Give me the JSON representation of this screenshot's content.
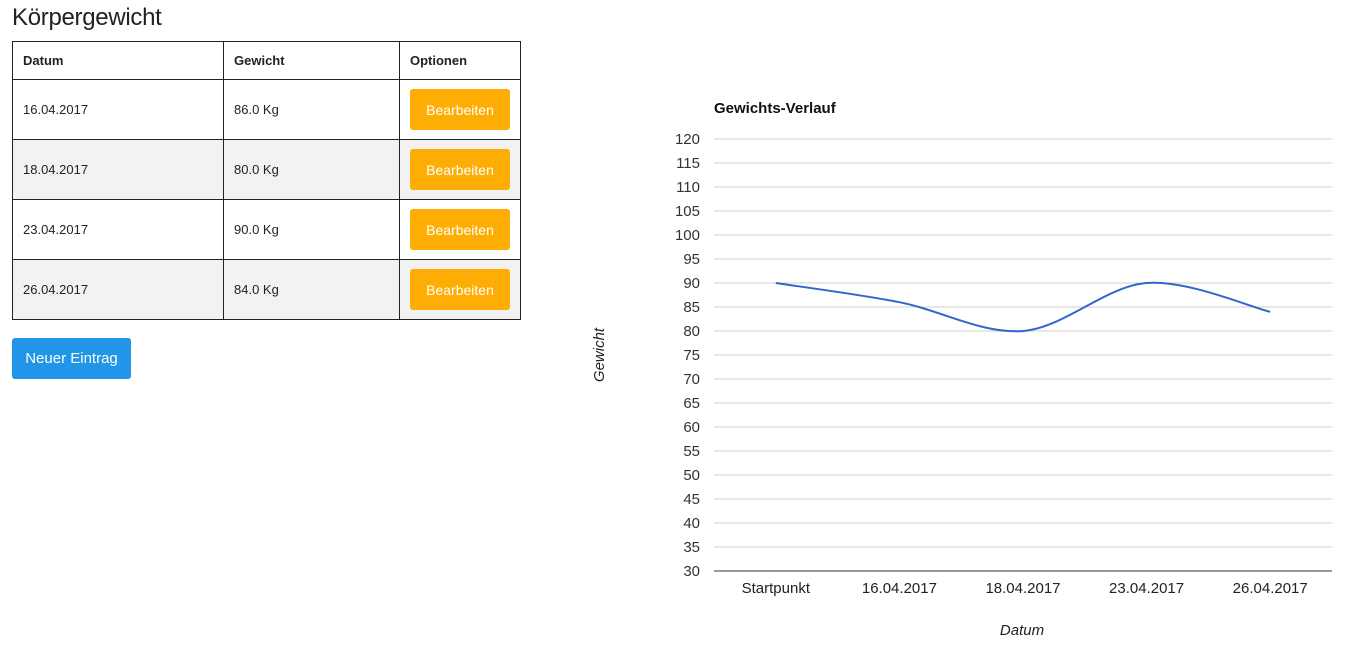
{
  "page": {
    "title": "Körpergewicht"
  },
  "table": {
    "headers": {
      "datum": "Datum",
      "gewicht": "Gewicht",
      "optionen": "Optionen"
    },
    "rows": [
      {
        "datum": "16.04.2017",
        "gewicht": "86.0 Kg",
        "action": "Bearbeiten"
      },
      {
        "datum": "18.04.2017",
        "gewicht": "80.0 Kg",
        "action": "Bearbeiten"
      },
      {
        "datum": "23.04.2017",
        "gewicht": "90.0 Kg",
        "action": "Bearbeiten"
      },
      {
        "datum": "26.04.2017",
        "gewicht": "84.0 Kg",
        "action": "Bearbeiten"
      }
    ]
  },
  "new_entry_label": "Neuer Eintrag",
  "colors": {
    "edit_button": "#fead04",
    "new_button": "#2196e8",
    "series": "#3366cc"
  },
  "chart_data": {
    "type": "line",
    "title": "Gewichts-Verlauf",
    "xlabel": "Datum",
    "ylabel": "Gewicht",
    "categories": [
      "Startpunkt",
      "16.04.2017",
      "18.04.2017",
      "23.04.2017",
      "26.04.2017"
    ],
    "series": [
      {
        "values": [
          90,
          86,
          80,
          90,
          84
        ]
      }
    ],
    "ylim": [
      30,
      120
    ],
    "ytick_step": 5,
    "grid": true,
    "smooth": true
  }
}
